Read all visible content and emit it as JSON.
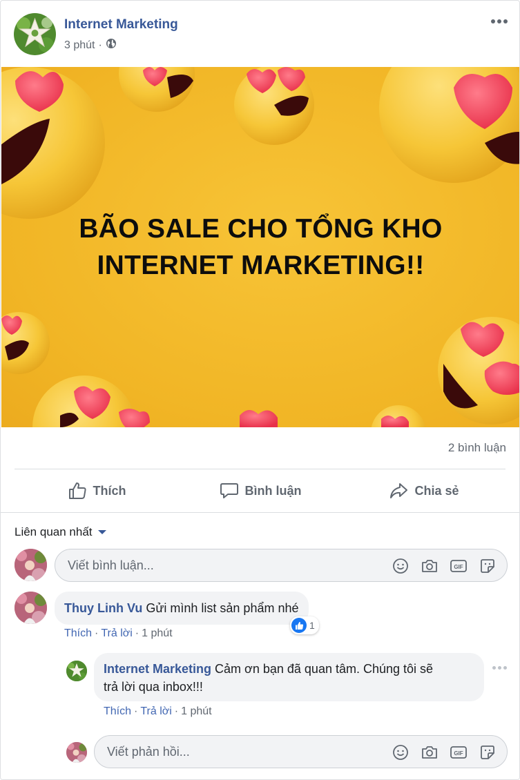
{
  "post": {
    "author": "Internet Marketing",
    "time": "3 phút",
    "time_sep": "·",
    "privacy_icon": "globe-icon",
    "image_headline_line1": "BÃO SALE CHO TỔNG KHO",
    "image_headline_line2": "INTERNET MARKETING!!",
    "comment_count": "2 bình luận"
  },
  "actions": {
    "like": "Thích",
    "comment": "Bình luận",
    "share": "Chia sẻ"
  },
  "comments": {
    "sort_label": "Liên quan nhất",
    "input_placeholder": "Viết bình luận...",
    "reply_placeholder": "Viết phản hồi...",
    "input_icons": [
      "emoji-icon",
      "camera-icon",
      "gif-icon",
      "sticker-icon"
    ],
    "items": [
      {
        "author": "Thuy Linh Vu",
        "text": "Gửi mình list sản phẩm nhé",
        "like_link": "Thích",
        "sep": "·",
        "reply_link": "Trả lời",
        "time": "1 phút",
        "reaction_count": "1"
      }
    ],
    "reply": {
      "author": "Internet Marketing",
      "text_line1": "Cảm ơn bạn đã quan tâm. Chúng tôi sẽ",
      "text_line2": "trả lời qua inbox!!!",
      "like_link": "Thích",
      "sep": "·",
      "reply_link": "Trả lời",
      "time": "1 phút"
    }
  },
  "colors": {
    "link": "#385898",
    "accent": "#4267b2",
    "muted": "#606770",
    "image_bg": "#f1b525",
    "emoji_yellow": "#f6c637",
    "heart_red": "#ef3f55"
  }
}
